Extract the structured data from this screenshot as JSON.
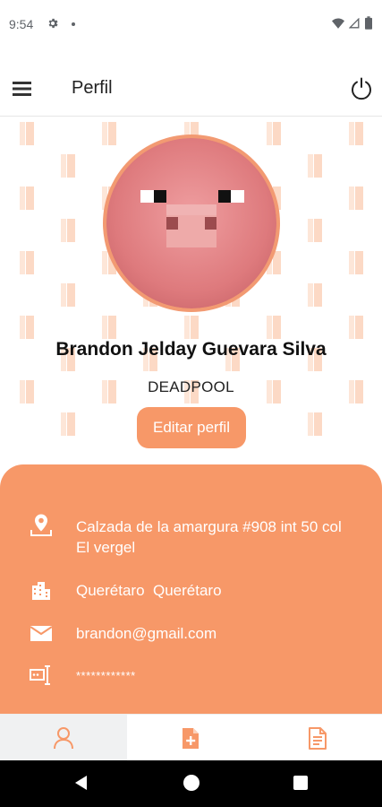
{
  "status_bar": {
    "time": "9:54",
    "icons": [
      "gear-icon",
      "notification-dot-icon",
      "wifi-icon",
      "signal-icon",
      "battery-icon"
    ]
  },
  "app_bar": {
    "title": "Perfil",
    "icons": [
      "menu-icon",
      "power-icon"
    ]
  },
  "profile": {
    "name": "Brandon Jelday Guevara Silva",
    "nickname": "DEADPOOL",
    "edit_button_label": "Editar perfil",
    "avatar_icon": "pig-face-avatar"
  },
  "info": {
    "address": "Calzada de la amargura #908 int 50 col El vergel",
    "city": "Querétaro  Querétaro",
    "email": "brandon@gmail.com",
    "password": "************"
  },
  "bottom_nav": {
    "tabs": [
      {
        "icon": "person-icon",
        "active": true
      },
      {
        "icon": "add-document-icon",
        "active": false
      },
      {
        "icon": "document-icon",
        "active": false
      }
    ]
  },
  "colors": {
    "accent": "#f79868",
    "avatar_background": "#e0787b",
    "pattern": "#fde3d3",
    "text_dark": "#111111",
    "white": "#ffffff",
    "system_nav": "#000000"
  }
}
